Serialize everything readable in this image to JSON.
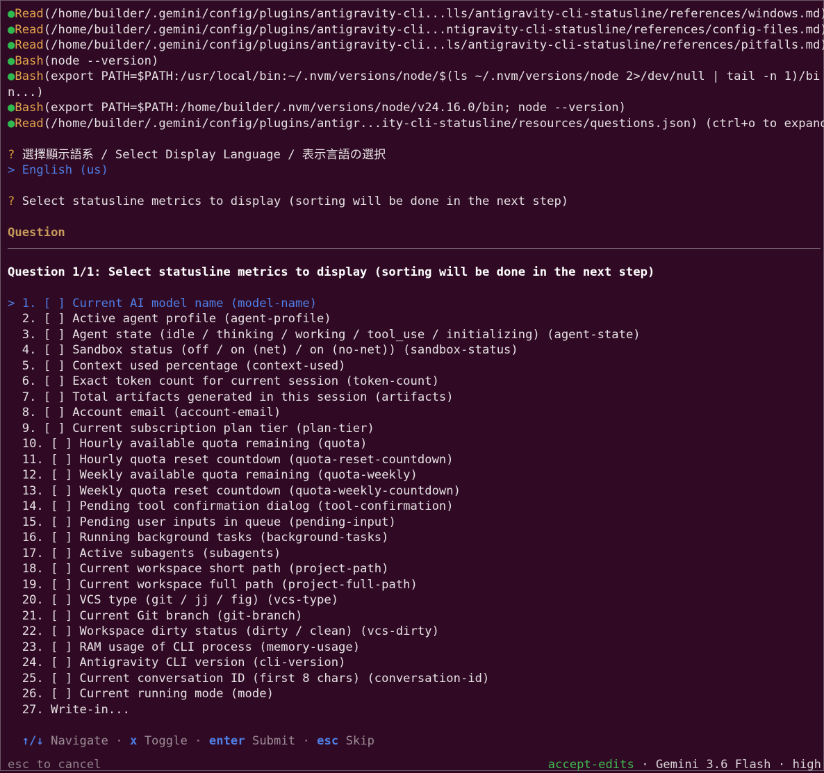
{
  "tool_calls": [
    {
      "tool": "Read",
      "args": "(/home/builder/.gemini/config/plugins/antigravity-cli...lls/antigravity-cli-statusline/references/windows.md)"
    },
    {
      "tool": "Read",
      "args": "(/home/builder/.gemini/config/plugins/antigravity-cli...ntigravity-cli-statusline/references/config-files.md)"
    },
    {
      "tool": "Read",
      "args": "(/home/builder/.gemini/config/plugins/antigravity-cli...ls/antigravity-cli-statusline/references/pitfalls.md)"
    },
    {
      "tool": "Bash",
      "args": "(node --version)"
    },
    {
      "tool": "Bash",
      "args": "(export PATH=$PATH:/usr/local/bin:~/.nvm/versions/node/$(ls ~/.nvm/versions/node 2>/dev/null | tail -n 1)/bin...)"
    },
    {
      "tool": "Bash",
      "args": "(export PATH=$PATH:/home/builder/.nvm/versions/node/v24.16.0/bin; node --version)"
    },
    {
      "tool": "Read",
      "args": "(/home/builder/.gemini/config/plugins/antigr...ity-cli-statusline/resources/questions.json) (ctrl+o to expand)"
    }
  ],
  "bullet": "●",
  "language_prompt": {
    "marker": "?",
    "text": " 選擇顯示語系 / Select Display Language / 表示言語の選択",
    "answer_marker": ">",
    "answer": " English (us)"
  },
  "metrics_prompt": {
    "marker": "?",
    "text": " Select statusline metrics to display (sorting will be done in the next step)"
  },
  "question_label": "Question",
  "question_heading": "Question 1/1: Select statusline metrics to display (sorting will be done in the next step)",
  "cursor": ">",
  "options": [
    {
      "num": "1.",
      "box": "[ ]",
      "label": "Current AI model name (model-name)"
    },
    {
      "num": "2.",
      "box": "[ ]",
      "label": "Active agent profile (agent-profile)"
    },
    {
      "num": "3.",
      "box": "[ ]",
      "label": "Agent state (idle / thinking / working / tool_use / initializing) (agent-state)"
    },
    {
      "num": "4.",
      "box": "[ ]",
      "label": "Sandbox status (off / on (net) / on (no-net)) (sandbox-status)"
    },
    {
      "num": "5.",
      "box": "[ ]",
      "label": "Context used percentage (context-used)"
    },
    {
      "num": "6.",
      "box": "[ ]",
      "label": "Exact token count for current session (token-count)"
    },
    {
      "num": "7.",
      "box": "[ ]",
      "label": "Total artifacts generated in this session (artifacts)"
    },
    {
      "num": "8.",
      "box": "[ ]",
      "label": "Account email (account-email)"
    },
    {
      "num": "9.",
      "box": "[ ]",
      "label": "Current subscription plan tier (plan-tier)"
    },
    {
      "num": "10.",
      "box": "[ ]",
      "label": "Hourly available quota remaining (quota)"
    },
    {
      "num": "11.",
      "box": "[ ]",
      "label": "Hourly quota reset countdown (quota-reset-countdown)"
    },
    {
      "num": "12.",
      "box": "[ ]",
      "label": "Weekly available quota remaining (quota-weekly)"
    },
    {
      "num": "13.",
      "box": "[ ]",
      "label": "Weekly quota reset countdown (quota-weekly-countdown)"
    },
    {
      "num": "14.",
      "box": "[ ]",
      "label": "Pending tool confirmation dialog (tool-confirmation)"
    },
    {
      "num": "15.",
      "box": "[ ]",
      "label": "Pending user inputs in queue (pending-input)"
    },
    {
      "num": "16.",
      "box": "[ ]",
      "label": "Running background tasks (background-tasks)"
    },
    {
      "num": "17.",
      "box": "[ ]",
      "label": "Active subagents (subagents)"
    },
    {
      "num": "18.",
      "box": "[ ]",
      "label": "Current workspace short path (project-path)"
    },
    {
      "num": "19.",
      "box": "[ ]",
      "label": "Current workspace full path (project-full-path)"
    },
    {
      "num": "20.",
      "box": "[ ]",
      "label": "VCS type (git / jj / fig) (vcs-type)"
    },
    {
      "num": "21.",
      "box": "[ ]",
      "label": "Current Git branch (git-branch)"
    },
    {
      "num": "22.",
      "box": "[ ]",
      "label": "Workspace dirty status (dirty / clean) (vcs-dirty)"
    },
    {
      "num": "23.",
      "box": "[ ]",
      "label": "RAM usage of CLI process (memory-usage)"
    },
    {
      "num": "24.",
      "box": "[ ]",
      "label": "Antigravity CLI version (cli-version)"
    },
    {
      "num": "25.",
      "box": "[ ]",
      "label": "Current conversation ID (first 8 chars) (conversation-id)"
    },
    {
      "num": "26.",
      "box": "[ ]",
      "label": "Current running mode (mode)"
    }
  ],
  "write_in": {
    "num": "27.",
    "label": "Write-in..."
  },
  "hints": {
    "navigate_key": "↑/↓",
    "navigate_label": "Navigate",
    "toggle_key": "x",
    "toggle_label": "Toggle",
    "submit_key": "enter",
    "submit_label": "Submit",
    "skip_key": "esc",
    "skip_label": "Skip",
    "separator": "·"
  },
  "status": {
    "cancel_hint": "esc to cancel",
    "mode": "accept-edits",
    "model": "Gemini 3.6 Flash",
    "effort": "high",
    "separator": "·"
  }
}
